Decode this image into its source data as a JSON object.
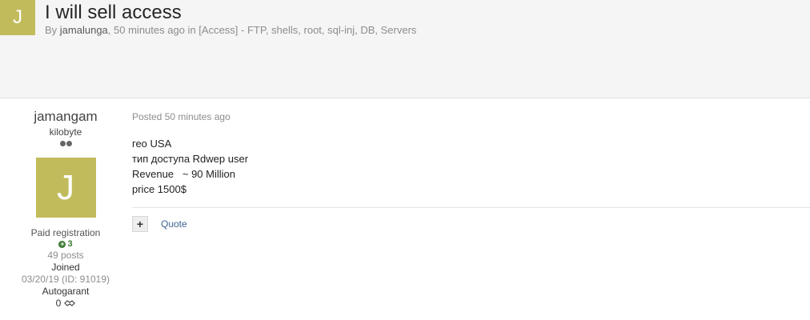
{
  "topic": {
    "avatar_letter": "J",
    "title": "I will sell access",
    "by_prefix": "By ",
    "author": "jamalunga",
    "comma": ", ",
    "time": "50 minutes ago",
    "in_prefix": " in ",
    "forum": "[Access] - FTP, shells, root, sql-inj, DB, Servers"
  },
  "author_panel": {
    "name": "jamangam",
    "title": "kilobyte",
    "avatar_letter": "J",
    "group": "Paid registration",
    "reputation": "3",
    "posts": "49 posts",
    "joined_label": "Joined",
    "joined_value": "03/20/19 (ID: 91019)",
    "field_label": "Autogarant",
    "field_value": "0"
  },
  "post": {
    "date": "Posted 50 minutes ago",
    "lines": [
      "гео USA",
      "тип доступа Rdwep user",
      "Revenue   ~ 90 Million",
      "price 1500$"
    ],
    "plus_label": "+",
    "quote_label": "Quote"
  },
  "colors": {
    "avatar_bg": "#c2bb5c",
    "link": "#3d6594",
    "rep": "#3c7a32"
  }
}
